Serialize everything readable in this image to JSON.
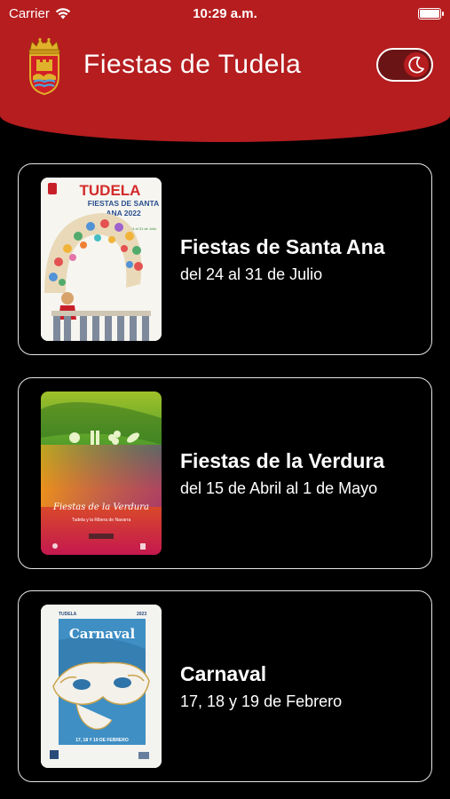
{
  "status_bar": {
    "carrier": "Carrier",
    "time": "10:29 a.m.",
    "battery_level": 1.0
  },
  "app": {
    "title": "Fiestas de Tudela",
    "crest_icon": "tudela-coat-of-arms",
    "theme_toggle_icon": "moon-icon",
    "accent_color": "#b51d1f",
    "background_color": "#000000"
  },
  "events": [
    {
      "name": "Fiestas de Santa Ana",
      "dates": "del 24 al 31 de Julio",
      "poster": {
        "title": "TUDELA",
        "subtitle": "FIESTAS DE SANTA ANA 2022",
        "small": "Del 24 al 31 de Julio"
      }
    },
    {
      "name": "Fiestas de la Verdura",
      "dates": "del 15 de Abril al 1 de Mayo",
      "poster": {
        "title": "Fiestas de la Verdura",
        "small": "Tudela y la Ribera de Navarra"
      }
    },
    {
      "name": "Carnaval",
      "dates": "17, 18 y 19 de Febrero",
      "poster": {
        "top_left": "TUDELA",
        "top_right": "2023",
        "title": "Carnaval",
        "bottom": "17, 18 Y 19 DE FEBRERO"
      }
    }
  ]
}
